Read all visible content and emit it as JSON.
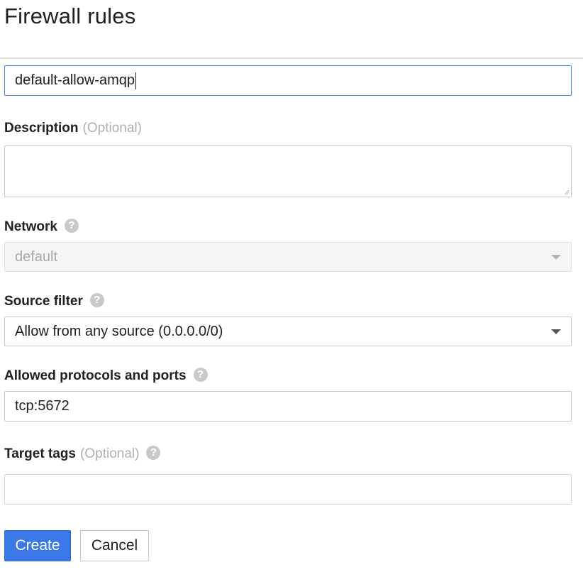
{
  "page": {
    "title": "Firewall rules"
  },
  "form": {
    "name": {
      "value": "default-allow-amqp"
    },
    "description": {
      "label": "Description",
      "optional": "(Optional)",
      "value": ""
    },
    "network": {
      "label": "Network",
      "selected": "default",
      "disabled": true
    },
    "source_filter": {
      "label": "Source filter",
      "selected": "Allow from any source (0.0.0.0/0)"
    },
    "allowed_protocols": {
      "label": "Allowed protocols and ports",
      "value": "tcp:5672"
    },
    "target_tags": {
      "label": "Target tags",
      "optional": "(Optional)",
      "value": ""
    }
  },
  "icons": {
    "help": "help-circle-icon",
    "dropdown": "chevron-down-icon",
    "help_glyph": "?"
  },
  "buttons": {
    "create": "Create",
    "cancel": "Cancel"
  },
  "colors": {
    "primary": "#3b78e7",
    "focus_border": "#4285f4",
    "muted_text": "#b0b0b0",
    "help_icon": "#c9c9c9"
  }
}
